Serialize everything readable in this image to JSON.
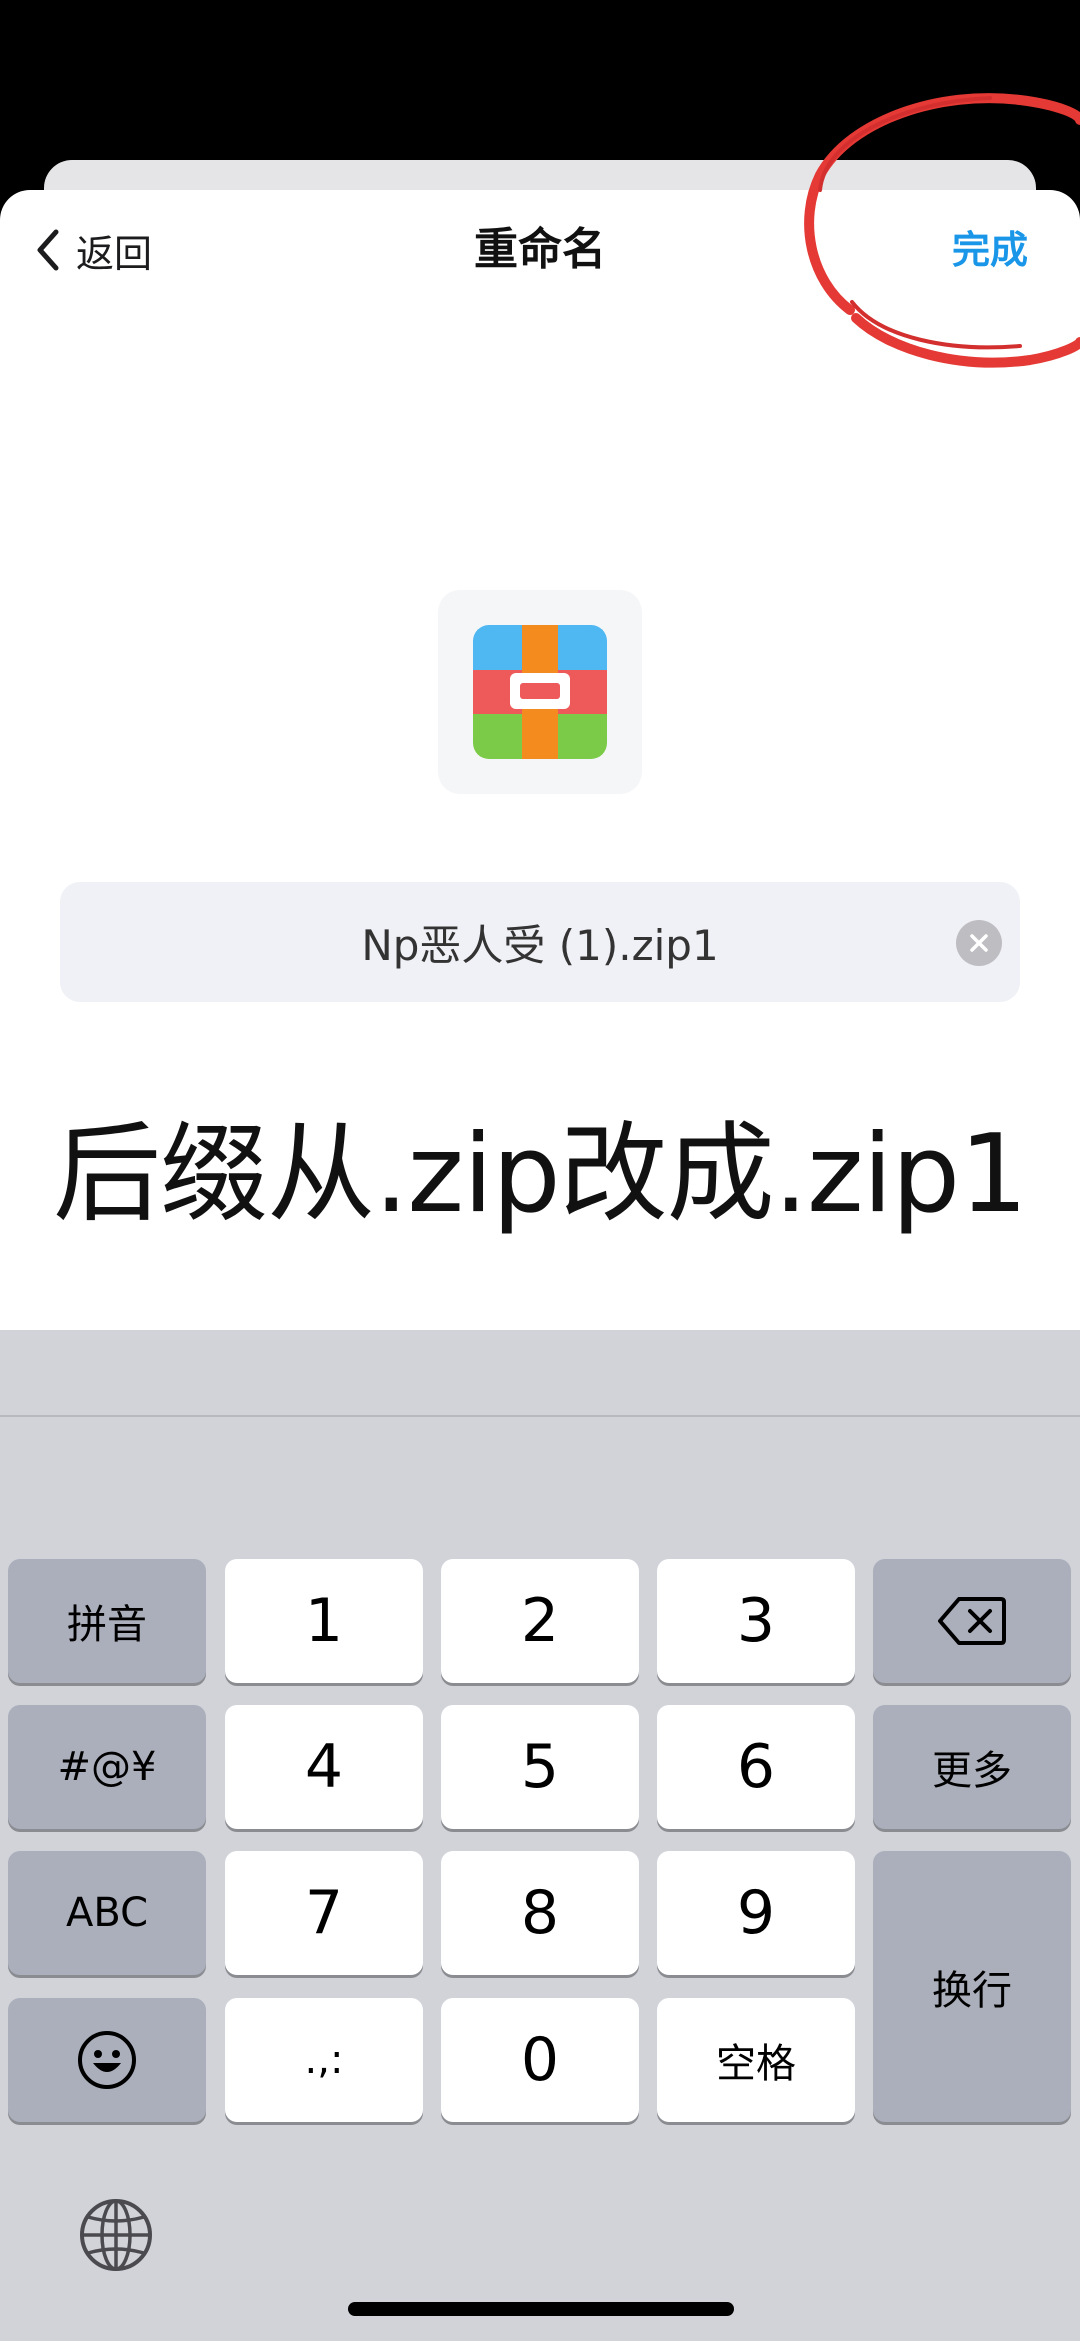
{
  "navbar": {
    "back_label": "返回",
    "title": "重命名",
    "done_label": "完成"
  },
  "file": {
    "icon": "archive-file-icon",
    "name_value": "Np恶人受 (1).zip1"
  },
  "annotation": {
    "text": "后缀从.zip改成.zip1",
    "circle_color": "#e53935"
  },
  "keyboard": {
    "left_keys": [
      "拼音",
      "#@¥",
      "ABC"
    ],
    "emoji_icon": "emoji-icon",
    "digits_row1": [
      "1",
      "2",
      "3"
    ],
    "digits_row2": [
      "4",
      "5",
      "6"
    ],
    "digits_row3": [
      "7",
      "8",
      "9"
    ],
    "punct": ".,:",
    "zero": "0",
    "space": "空格",
    "more": "更多",
    "return": "换行",
    "delete_icon": "backspace-icon",
    "globe_icon": "globe-icon"
  },
  "colors": {
    "accent": "#1a96e8",
    "keyboard_bg": "#d1d3d9",
    "dark_key": "#abafbb"
  }
}
